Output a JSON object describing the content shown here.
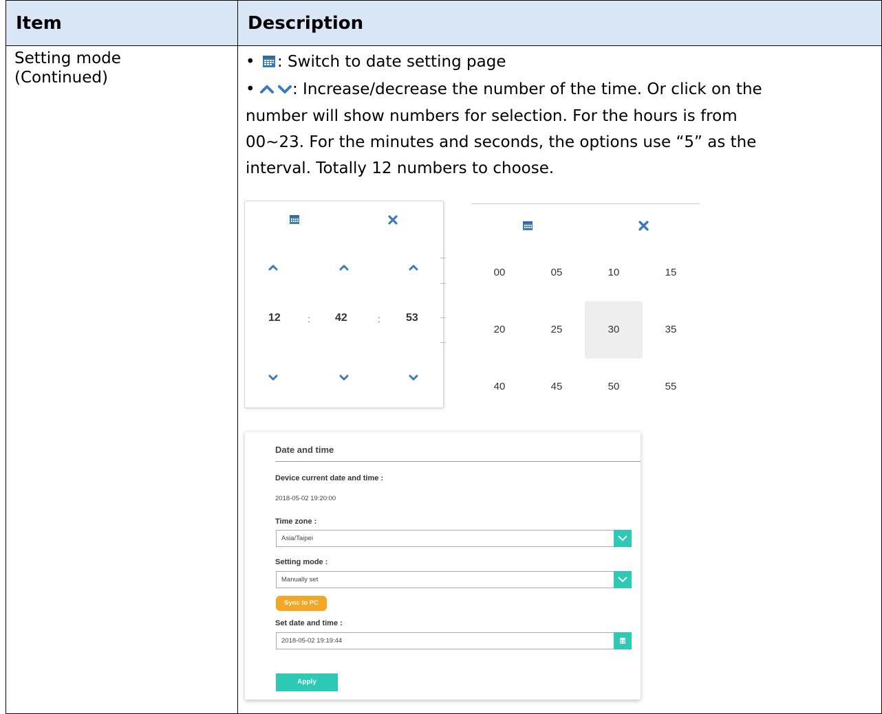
{
  "table": {
    "header_item": "Item",
    "header_description": "Description",
    "item_line1": "Setting mode",
    "item_line2": "(Continued)",
    "bullet_calendar_text": ": Switch to date setting page",
    "bullet_arrows_text": ": Increase/decrease the number of the time. Or click on the",
    "desc_line2": "number will show numbers for selection. For the hours is from",
    "desc_line3": "00~23. For the minutes and seconds, the options use “5” as the",
    "desc_line4": "interval. Totally 12 numbers to choose."
  },
  "time_picker": {
    "hours": "12",
    "minutes": "42",
    "seconds": "53",
    "separator": ":",
    "icons": [
      "calendar-icon",
      "close-icon",
      "chevron-up-icon",
      "chevron-down-icon"
    ]
  },
  "minute_picker": {
    "values": [
      "00",
      "05",
      "10",
      "15",
      "20",
      "25",
      "30",
      "35",
      "40",
      "45",
      "50",
      "55"
    ],
    "selected": "30"
  },
  "settings_panel": {
    "title": "Date and time",
    "current_label": "Device current date and time :",
    "current_value": "2018-05-02 19:20:00",
    "timezone_label": "Time zone :",
    "timezone_value": "Asia/Taipei",
    "mode_label": "Setting mode :",
    "mode_value": "Manually set",
    "sync_button": "Sync to PC",
    "set_label": "Set date and time :",
    "set_value": "2018-05-02 19:19:44",
    "apply_button": "Apply"
  },
  "colors": {
    "header_bg": "#d9e6f5",
    "icon_blue": "#3a7bbf",
    "accent_teal": "#2ccab4",
    "sync_orange": "#f5a623"
  }
}
